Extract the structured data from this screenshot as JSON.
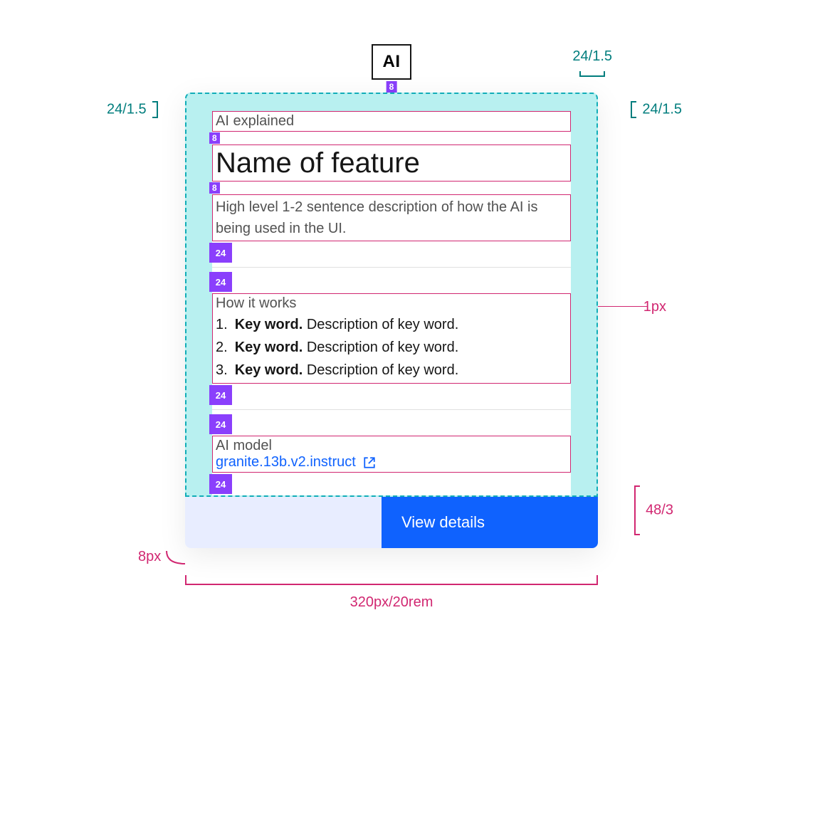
{
  "badge": {
    "label": "AI",
    "gap_below": "8"
  },
  "annotations": {
    "pad_top_left": "24/1.5",
    "pad_top_right": "24/1.5",
    "pad_top_right_h": "24/1.5",
    "hairline": "1px",
    "footer_height": "48/3",
    "corner_radius": "8px",
    "total_width": "320px/20rem"
  },
  "gaps": {
    "small": "8",
    "block": "24"
  },
  "card": {
    "eyebrow": "AI explained",
    "title": "Name of feature",
    "description": "High level 1-2 sentence description of how the AI is being used in the UI.",
    "how_label": "How it works",
    "steps": [
      {
        "kw": "Key word.",
        "rest": "Description of key word."
      },
      {
        "kw": "Key word.",
        "rest": "Description of key word."
      },
      {
        "kw": "Key word.",
        "rest": "Description of key word."
      }
    ],
    "model_label": "AI model",
    "model_link": "granite.13b.v2.instruct",
    "cta": "View details"
  }
}
